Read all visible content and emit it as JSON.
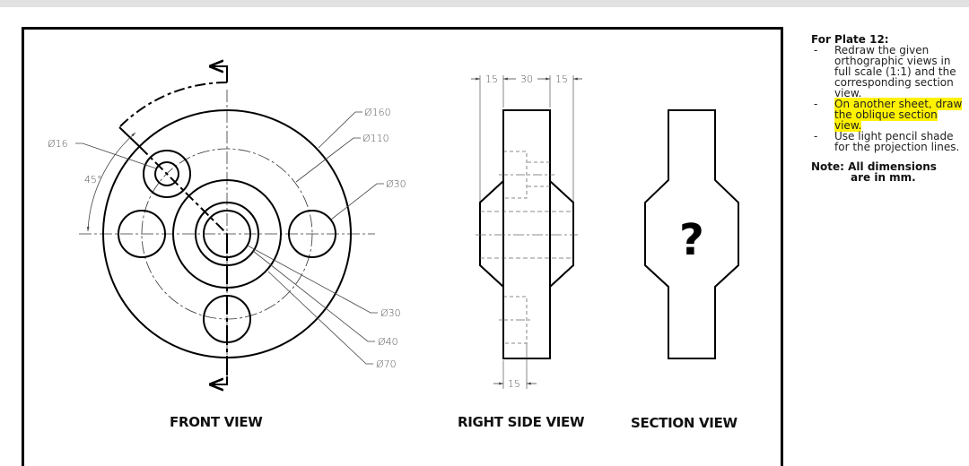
{
  "drawing": {
    "front_view": {
      "label": "FRONT VIEW",
      "dimensions": {
        "outer_diameter": "Ø160",
        "bolt_circle": "Ø110",
        "bolt_hole": "Ø30",
        "small_hole": "Ø16",
        "angle": "45°",
        "bore": "Ø30",
        "counterbore": "Ø40",
        "hub": "Ø70"
      }
    },
    "right_side_view": {
      "label": "RIGHT SIDE VIEW",
      "dimensions": {
        "left_flange": "15",
        "hub_width": "30",
        "right_flange": "15",
        "bottom_depth": "15"
      }
    },
    "section_view": {
      "label": "SECTION VIEW",
      "placeholder": "?"
    }
  },
  "instructions": {
    "title": "For Plate 12:",
    "items": [
      {
        "bullet": "-",
        "text": "Redraw the given orthographic views in full scale (1:1) and the corresponding section view.",
        "highlighted": false
      },
      {
        "bullet": "-",
        "text": "On another sheet, draw the oblique section view.",
        "highlighted": true
      },
      {
        "bullet": "-",
        "text": "Use light pencil shade for the projection lines.",
        "highlighted": false
      }
    ],
    "note_line1": "Note: All dimensions",
    "note_line2": "are in mm.",
    "highlight_color": "#fff200"
  }
}
